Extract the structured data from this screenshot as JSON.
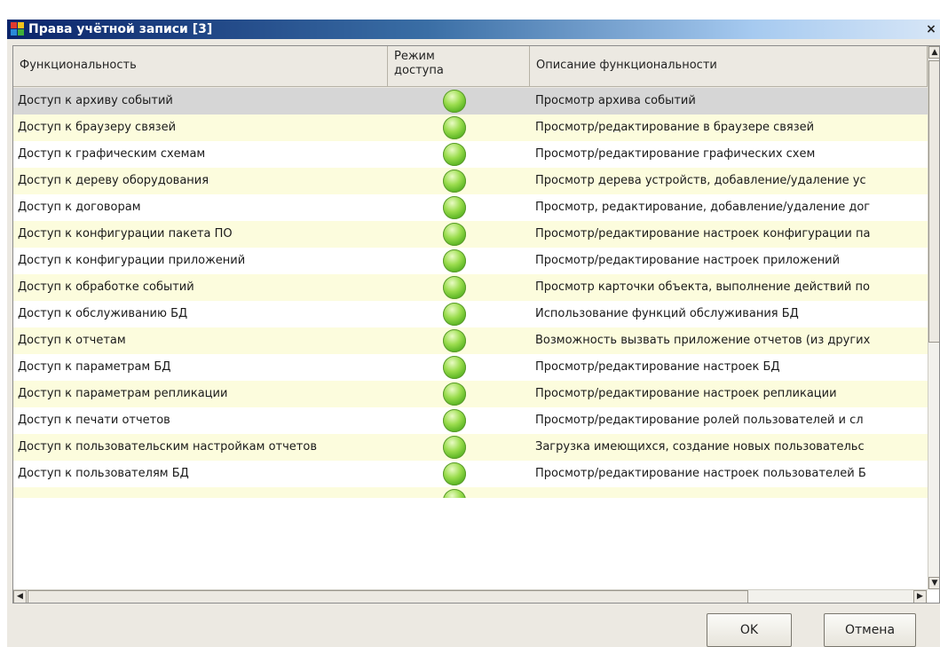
{
  "window": {
    "title": "Права учётной записи [3]",
    "close": "×"
  },
  "columns": [
    "Функциональность",
    "Режим доступа",
    "Описание функциональности"
  ],
  "rows": [
    {
      "name": "Доступ к архиву событий",
      "desc": "Просмотр архива событий"
    },
    {
      "name": "Доступ к браузеру связей",
      "desc": "Просмотр/редактирование в браузере связей"
    },
    {
      "name": "Доступ к графическим схемам",
      "desc": "Просмотр/редактирование графических схем"
    },
    {
      "name": "Доступ к дереву оборудования",
      "desc": "Просмотр дерева устройств, добавление/удаление ус"
    },
    {
      "name": "Доступ к договорам",
      "desc": "Просмотр, редактирование, добавление/удаление дог"
    },
    {
      "name": "Доступ к конфигурации пакета ПО",
      "desc": "Просмотр/редактирование настроек конфигурации па"
    },
    {
      "name": "Доступ к конфигурации приложений",
      "desc": "Просмотр/редактирование настроек приложений"
    },
    {
      "name": "Доступ к обработке событий",
      "desc": "Просмотр карточки объекта, выполнение действий по"
    },
    {
      "name": "Доступ к обслуживанию БД",
      "desc": "Использование функций обслуживания БД"
    },
    {
      "name": "Доступ к отчетам",
      "desc": "Возможность вызвать приложение отчетов (из других"
    },
    {
      "name": "Доступ к параметрам БД",
      "desc": "Просмотр/редактирование настроек БД"
    },
    {
      "name": "Доступ к параметрам репликации",
      "desc": "Просмотр/редактирование настроек репликации"
    },
    {
      "name": "Доступ к печати отчетов",
      "desc": "Просмотр/редактирование ролей пользователей и сл"
    },
    {
      "name": "Доступ к пользовательским настройкам отчетов",
      "desc": "Загрузка имеющихся, создание новых пользовательс"
    },
    {
      "name": "Доступ к пользователям БД",
      "desc": "Просмотр/редактирование настроек пользователей Б"
    }
  ],
  "access_icon": "green-circle-icon",
  "buttons": {
    "ok": "OK",
    "cancel": "Отмена"
  },
  "colors": {
    "accent": "#0a246a",
    "status_on": "#4fae1c",
    "row_alt": "#fcfcdd"
  }
}
